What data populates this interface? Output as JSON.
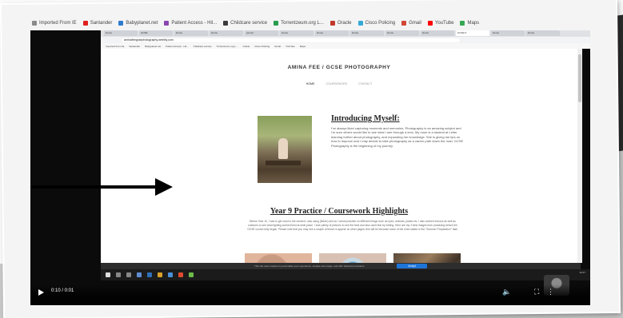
{
  "bookmarks_outer": [
    "Imported From IE",
    "Santander",
    "Babyplanet.net",
    "Patient Access - Hil...",
    "Childcare service",
    "Torrentzeum.org L...",
    "Oracle",
    "Cisco Policing",
    "Gmail",
    "YouTube",
    "Maps"
  ],
  "browser": {
    "tabs": [
      "Home",
      "GCSE",
      "Home",
      "Home",
      "person",
      "Home",
      "Home",
      "Home",
      "Home",
      "Home",
      "GCSE P",
      "Home",
      "Home"
    ],
    "url": "aminafeegcsephotography.weebly.com"
  },
  "site": {
    "title": "AMINA FEE / GCSE PHOTOGRAPHY",
    "nav": [
      "HOME",
      "COURSEWORK",
      "CONTACT"
    ],
    "intro_heading": "Introducing Myself:",
    "intro_text": "I've always liked capturing moments and memories. Photography is an amazing subject and I'm sure others would like to see what I see through a lens. My mum is a student at Leiter learning further about photography, and expanding her knowledge. She is giving me tips on how to improve and I may decide to take photography as a career path down the road. GCSE Photography is the beginning of my journey.",
    "practice_heading": "Year 9 Practice / Coursework Highlights",
    "practice_text": "Before Year 10, I had to get used to the camera I was using (Nikon) and so I would practise on different things such as eyes, animals, plants etc. I also worked indoors as well as outdoors to see what lighting worked best at what place. I took plenty of pictures to see the best and also used test try editing. Here are my 3 best images from practising before the GCSE course fully began. Please note that you may see a couple of these re-appear on other pages; this will be because some of the ones stated in the \"Summer Preparation\" task."
  },
  "cookie_bar": {
    "text": "This site uses cookies to personalise your experience, analyse site usage, and offer tailored promotions.",
    "accept_label": "Accept"
  },
  "os_time": "10:27",
  "video": {
    "time": "0:10 / 0:01"
  }
}
